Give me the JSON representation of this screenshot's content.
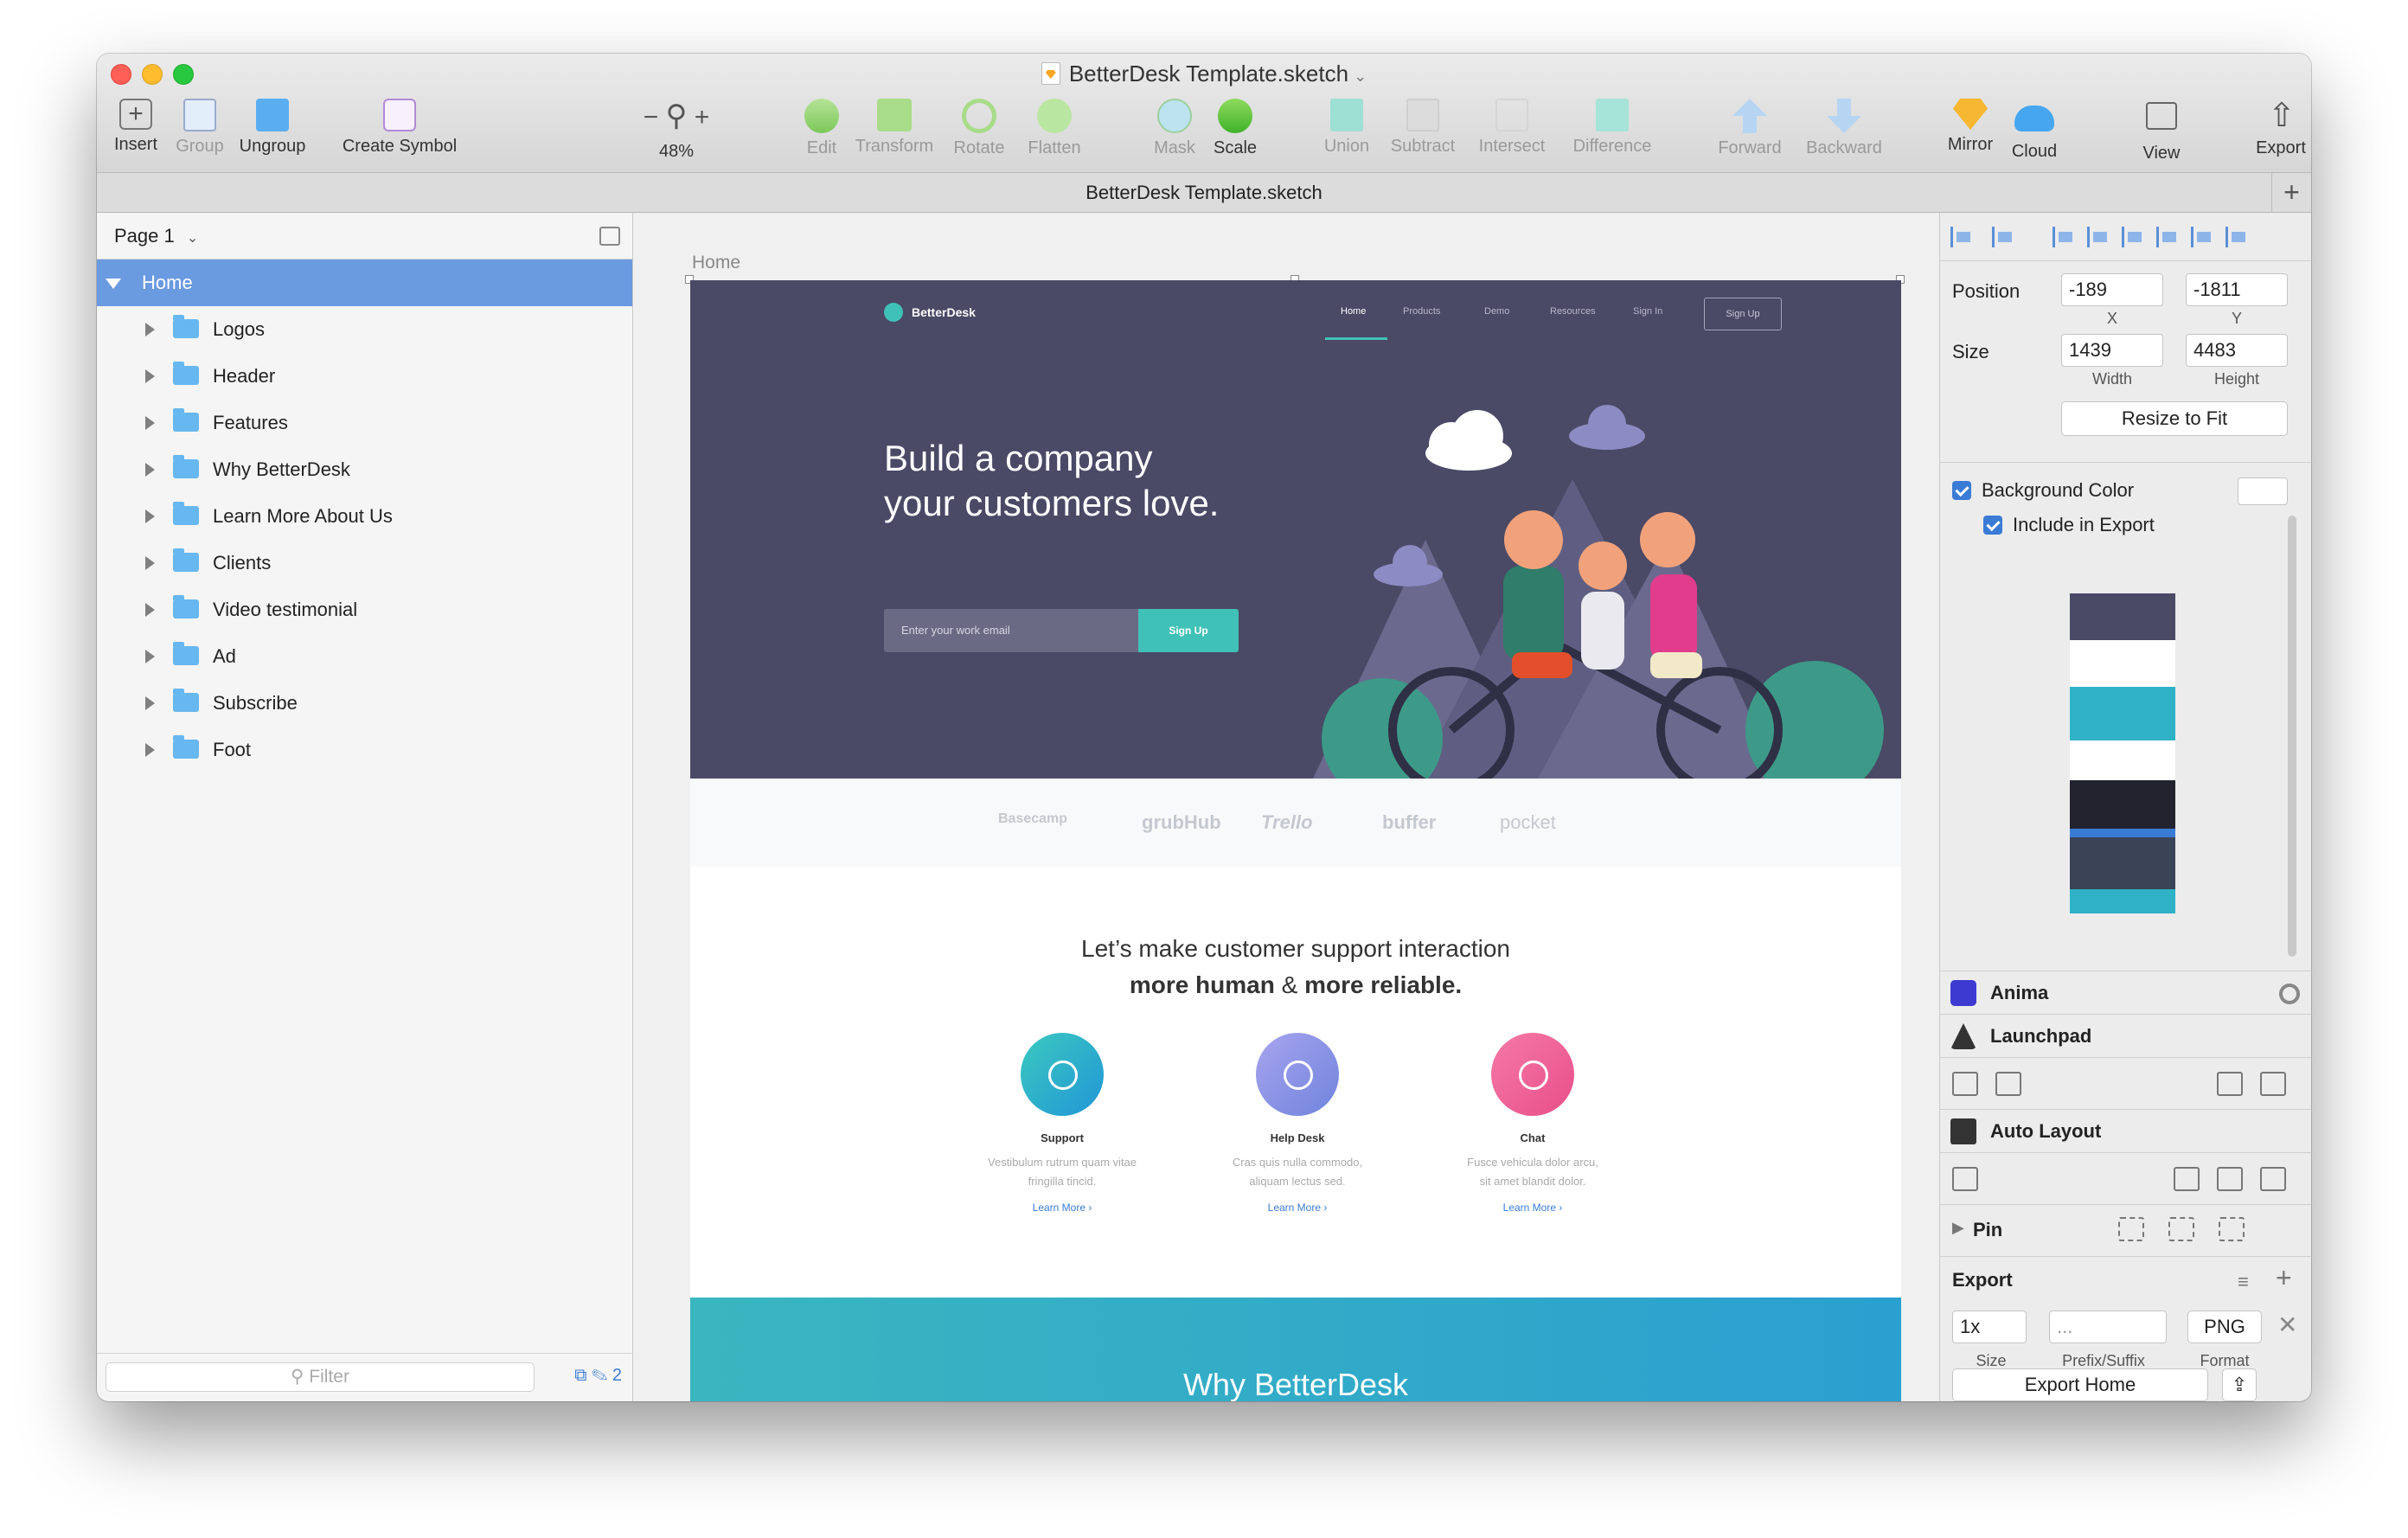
{
  "window": {
    "title": "BetterDesk Template.sketch",
    "tab_title": "BetterDesk Template.sketch"
  },
  "toolbar": {
    "insert": "Insert",
    "group": "Group",
    "ungroup": "Ungroup",
    "create_symbol": "Create Symbol",
    "zoom": "48%",
    "edit": "Edit",
    "transform": "Transform",
    "rotate": "Rotate",
    "flatten": "Flatten",
    "mask": "Mask",
    "scale": "Scale",
    "union": "Union",
    "subtract": "Subtract",
    "intersect": "Intersect",
    "difference": "Difference",
    "forward": "Forward",
    "backward": "Backward",
    "mirror": "Mirror",
    "cloud": "Cloud",
    "view": "View",
    "export": "Export"
  },
  "layers": {
    "page": "Page 1",
    "artboard": "Home",
    "items": [
      "Logos",
      "Header",
      "Features",
      "Why BetterDesk",
      "Learn More About Us",
      "Clients",
      "Video testimonial",
      "Ad",
      "Subscribe",
      "Foot"
    ],
    "filter_placeholder": "Filter",
    "footer_count": "2"
  },
  "canvas": {
    "artboard_label": "Home",
    "site": {
      "logo": "BetterDesk",
      "nav": [
        "Home",
        "Products",
        "Demo",
        "Resources",
        "Sign In"
      ],
      "nav_button": "Sign Up",
      "hero_title": "Build a company your customers love.",
      "email_placeholder": "Enter your work email",
      "email_button": "Sign Up",
      "client_logos": [
        "Basecamp",
        "grubHub",
        "Trello",
        "buffer",
        "pocket"
      ],
      "features_line1": "Let’s make customer support interaction",
      "features_line2_a": "more human",
      "features_line2_b": "&",
      "features_line2_c": "more reliable.",
      "features": [
        {
          "name": "Support",
          "desc1": "Vestibulum rutrum quam vitae",
          "desc2": "fringilla tincid.",
          "link": "Learn More ›",
          "color": "#27a9c9"
        },
        {
          "name": "Help Desk",
          "desc1": "Cras quis nulla commodo,",
          "desc2": "aliquam lectus sed.",
          "link": "Learn More ›",
          "color": "#8e92e6"
        },
        {
          "name": "Chat",
          "desc1": "Fusce vehicula dolor arcu,",
          "desc2": "sit amet blandit dolor.",
          "link": "Learn More ›",
          "color": "#f0659a"
        }
      ],
      "why_title": "Why BetterDesk"
    }
  },
  "inspector": {
    "position_label": "Position",
    "x": "-189",
    "y": "-1811",
    "x_label": "X",
    "y_label": "Y",
    "size_label": "Size",
    "width": "1439",
    "height": "4483",
    "width_label": "Width",
    "height_label": "Height",
    "resize_button": "Resize to Fit",
    "bg_color": "Background Color",
    "include_export": "Include in Export",
    "anima": "Anima",
    "launchpad": "Launchpad",
    "auto_layout": "Auto Layout",
    "pin": "Pin",
    "export_title": "Export",
    "export_size": "1x",
    "export_prefix": "...",
    "export_format": "PNG",
    "size_label2": "Size",
    "prefix_label": "Prefix/Suffix",
    "format_label": "Format",
    "export_button": "Export Home"
  }
}
